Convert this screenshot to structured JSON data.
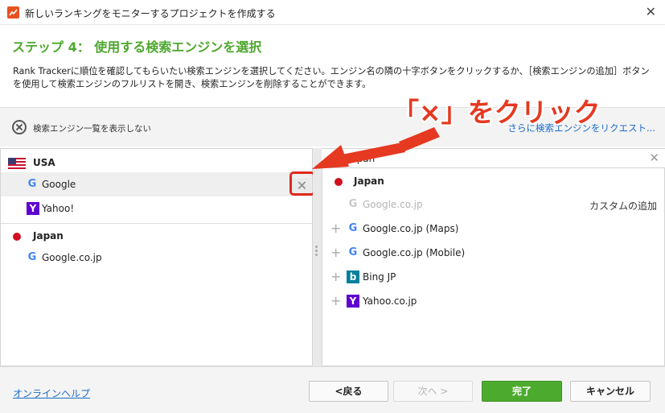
{
  "window": {
    "title": "新しいランキングをモニターするプロジェクトを作成する",
    "close_glyph": "✕"
  },
  "step": {
    "title": "ステップ 4： 使用する検索エンジンを選択",
    "description": "Rank Trackerに順位を確認してもらいたい検索エンジンを選択してください。エンジン名の隣の十字ボタンをクリックするか、［検索エンジンの追加］ボタンを使用して検索エンジンのフルリストを開き、検索エンジンを削除することができます。"
  },
  "toolbar": {
    "hide_label": "検索エンジン一覧を表示しない",
    "request_link": "さらに検索エンジンをリクエスト..."
  },
  "left_panel": {
    "groups": [
      {
        "country": "USA",
        "engines": [
          "Google",
          "Yahoo!"
        ]
      },
      {
        "country": "Japan",
        "engines": [
          "Google.co.jp"
        ]
      }
    ],
    "remove_glyph": "✕"
  },
  "right_panel": {
    "search_value": "japan",
    "clear_glyph": "✕",
    "country": "Japan",
    "custom_add": "カスタムの追加",
    "added_engine": "Google.co.jp",
    "available": [
      "Google.co.jp (Maps)",
      "Google.co.jp (Mobile)",
      "Bing JP",
      "Yahoo.co.jp"
    ],
    "add_glyph": "+"
  },
  "annotation": {
    "text": "「×」をクリック",
    "color": "#e53921"
  },
  "footer": {
    "help": "オンラインヘルプ",
    "back": "<戻る",
    "next": "次へ >",
    "finish": "完了",
    "cancel": "キャンセル"
  },
  "colors": {
    "accent_green": "#4ea72e",
    "link_blue": "#1a6dc8",
    "button_green": "#4cab2e"
  },
  "icons": [
    "app-icon",
    "close-icon",
    "hide-icon",
    "us-flag-icon",
    "jp-flag-icon",
    "google-icon",
    "yahoo-icon",
    "bing-icon",
    "plus-icon",
    "remove-icon",
    "clear-icon"
  ]
}
